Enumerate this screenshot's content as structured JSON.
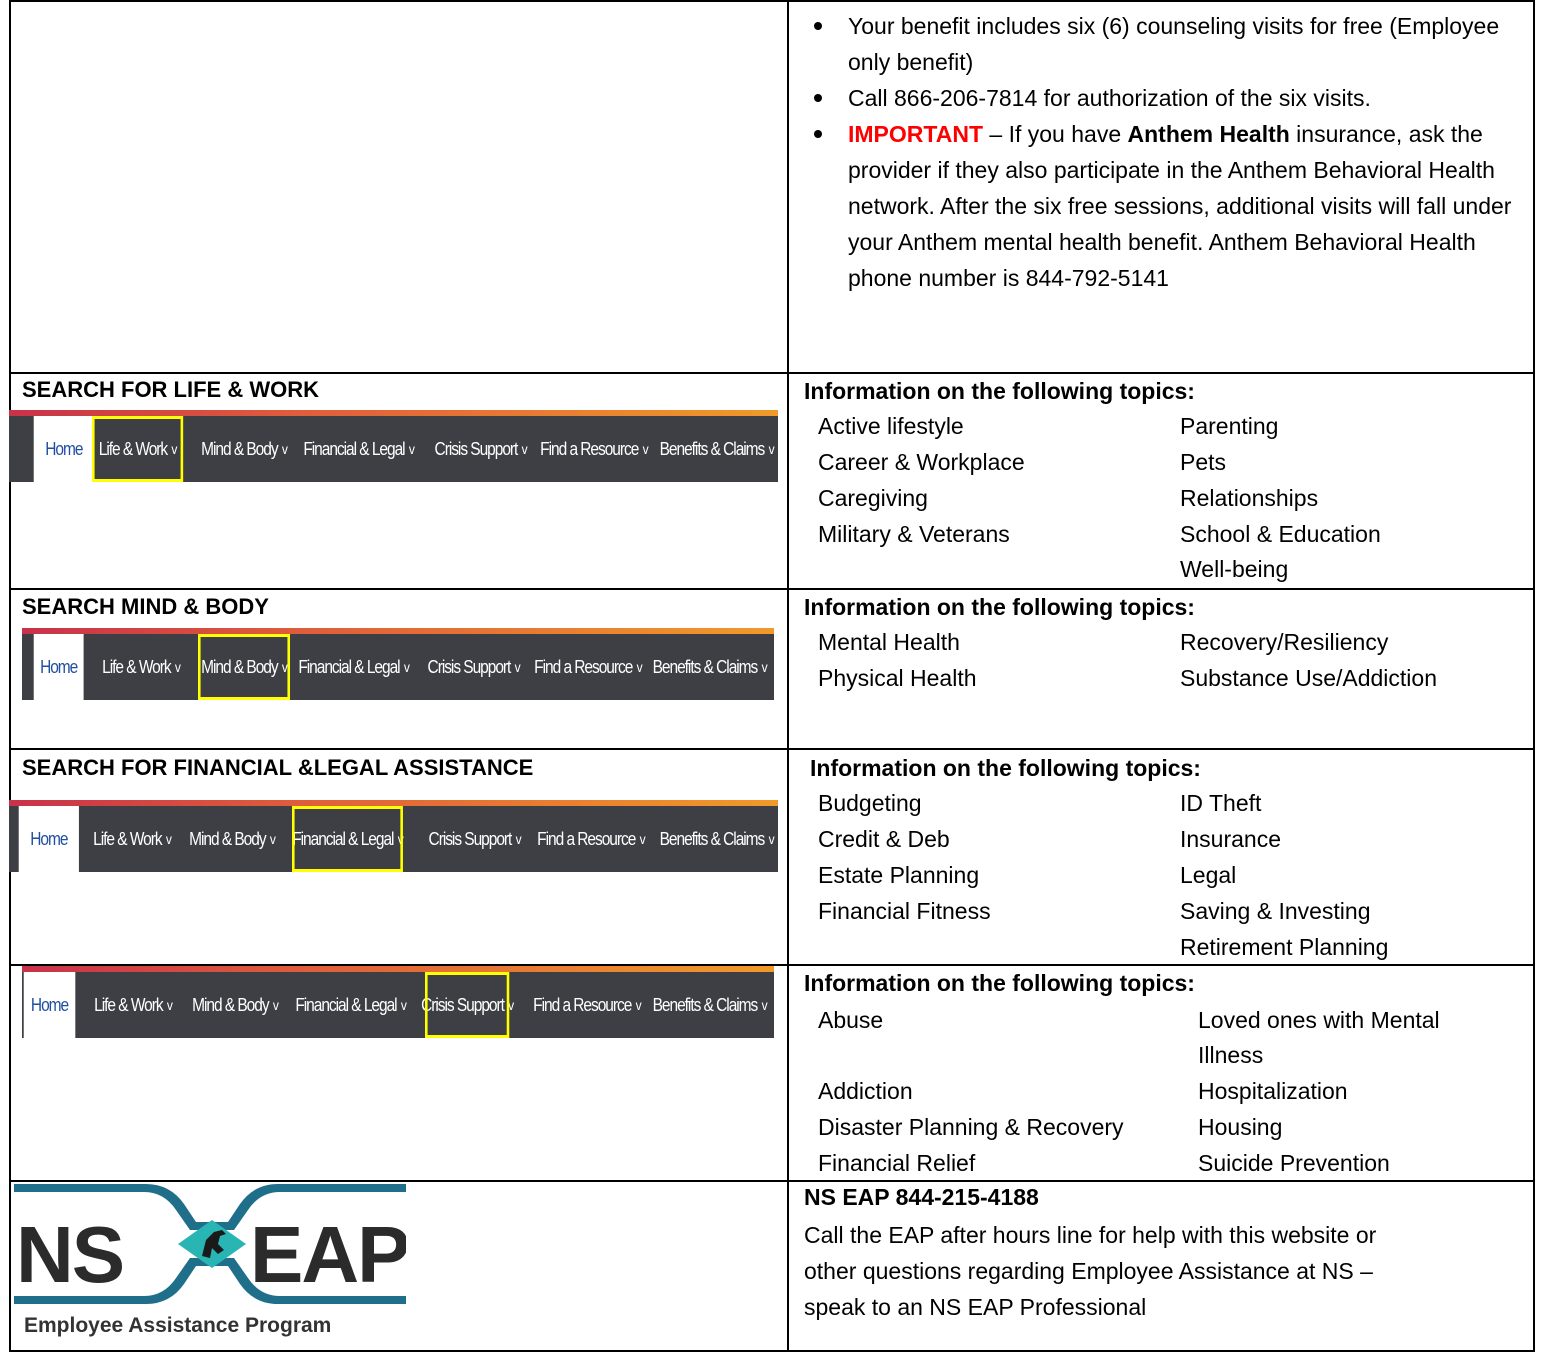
{
  "intro": {
    "bullets": [
      {
        "text": "Your benefit includes six (6) counseling visits for free (Employee only benefit)"
      },
      {
        "text": "Call 866-206-7814 for authorization of the six visits."
      },
      {
        "important": "IMPORTANT",
        "pre": " – If you have ",
        "bold": "Anthem Health",
        "post": " insurance, ask the provider if they also participate in the Anthem Behavioral Health network.   After the six free sessions, additional visits will fall under your Anthem mental health benefit.  Anthem Behavioral Health phone number is 844-792-5141"
      }
    ]
  },
  "nav": {
    "items": [
      "Home",
      "Life & Work",
      "Mind & Body",
      "Financial & Legal",
      "Crisis Support",
      "Find a Resource",
      "Benefits & Claims"
    ],
    "chevron": "v"
  },
  "sections": [
    {
      "heading": "SEARCH FOR LIFE & WORK",
      "highlight": "Life & Work",
      "topics_title": "Information on the following topics:",
      "col1": [
        "Active lifestyle",
        "Career & Workplace",
        "Caregiving",
        "Military & Veterans"
      ],
      "col2": [
        "Parenting",
        "Pets",
        "Relationships",
        "School & Education",
        "Well-being"
      ]
    },
    {
      "heading": "SEARCH MIND & BODY",
      "highlight": "Mind & Body",
      "topics_title": "Information on the following topics:",
      "col1": [
        "Mental Health",
        "Physical Health"
      ],
      "col2": [
        "Recovery/Resiliency",
        "Substance Use/Addiction"
      ]
    },
    {
      "heading": "SEARCH FOR FINANCIAL &LEGAL ASSISTANCE",
      "highlight": "Financial & Legal",
      "topics_title": "Information on the following topics:",
      "col1": [
        "Budgeting",
        "Credit & Deb",
        "Estate Planning",
        "Financial Fitness"
      ],
      "col2": [
        "ID Theft",
        "Insurance",
        "Legal",
        "Saving & Investing",
        "Retirement Planning"
      ]
    },
    {
      "heading": "",
      "highlight": "Crisis Support",
      "topics_title": "Information on the following topics:",
      "col1": [
        "Abuse",
        "",
        "Addiction",
        "Disaster Planning & Recovery",
        "Financial Relief"
      ],
      "col2": [
        "Loved ones with Mental",
        "Illness",
        "Hospitalization",
        "Housing",
        "Suicide Prevention"
      ]
    }
  ],
  "logo": {
    "left": "NS",
    "right": "EAP",
    "tagline": "Employee Assistance Program",
    "colors": {
      "dark": "#2b2b2b",
      "teal": "#1f6f8b",
      "aqua": "#2ab5b5"
    }
  },
  "contact": {
    "title": "NS EAP 844-215-4188",
    "body_lines": [
      "Call the EAP after hours line for help with this website or",
      "other questions regarding Employee Assistance at NS –",
      "speak to an NS EAP Professional"
    ]
  }
}
